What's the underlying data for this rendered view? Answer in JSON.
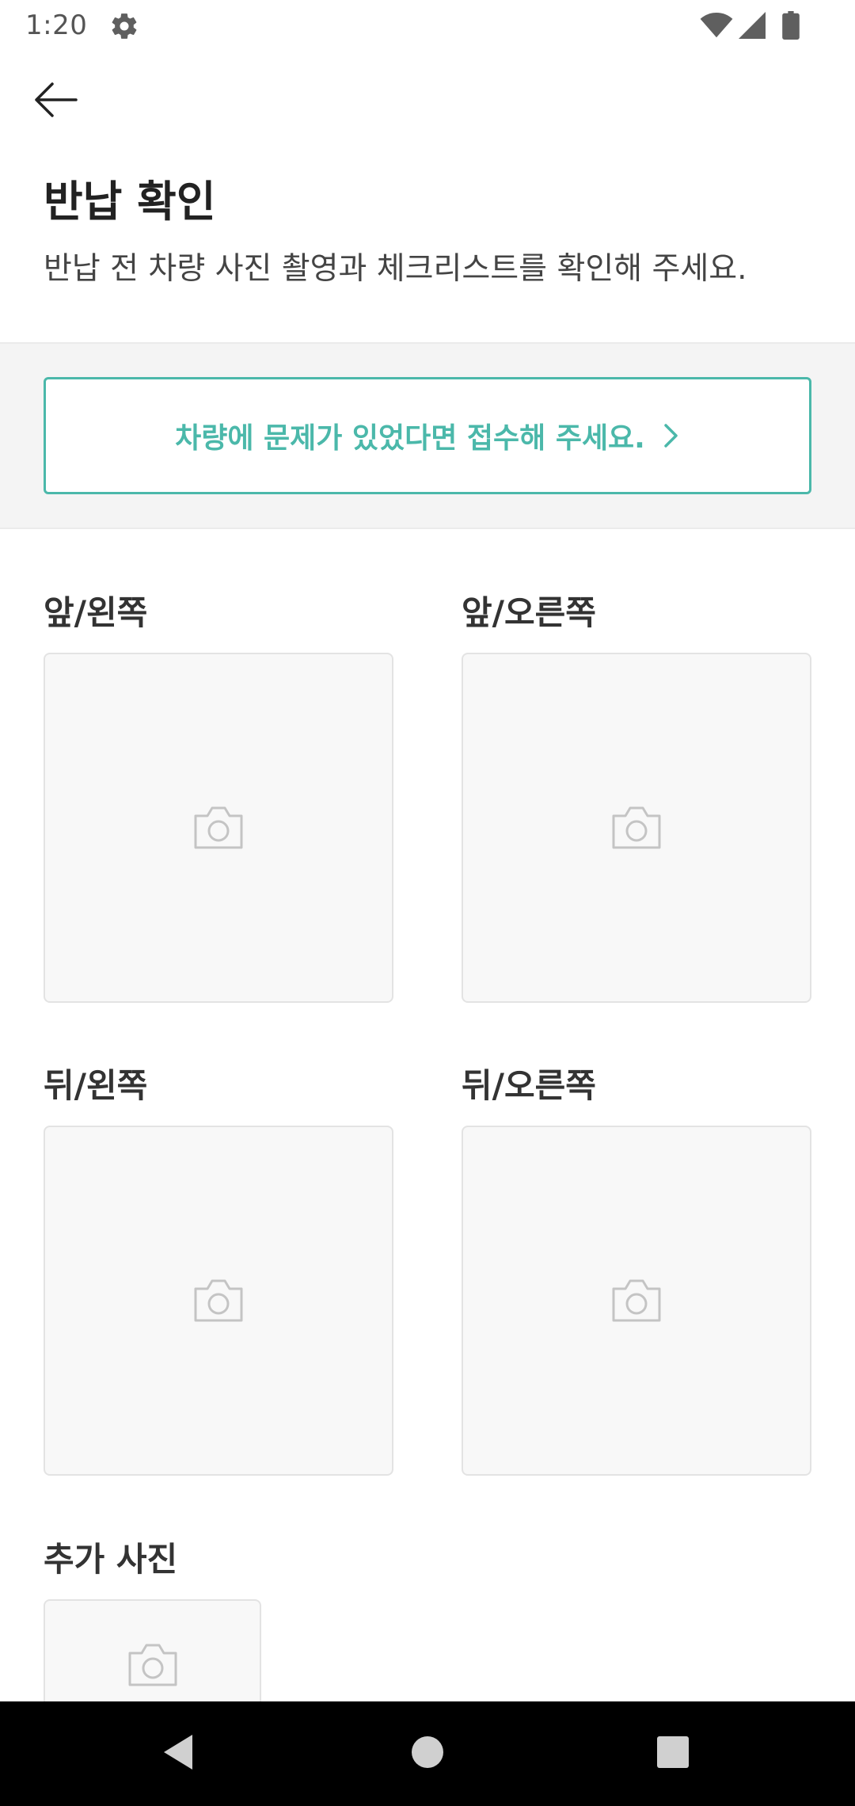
{
  "status_bar": {
    "time": "1:20",
    "icons": [
      "settings-gear-icon",
      "wifi-icon",
      "cellular-signal-icon",
      "battery-icon"
    ]
  },
  "header": {
    "back_icon": "arrow-left-icon",
    "title": "반납 확인",
    "subtitle": "반납 전 차량 사진 촬영과 체크리스트를 확인해 주세요."
  },
  "banner": {
    "label": "차량에 문제가 있었다면 접수해 주세요.",
    "chevron_icon": "chevron-right-icon",
    "accent_color": "#4bb8aa"
  },
  "photos": {
    "front_left": {
      "label": "앞/왼쪽",
      "icon": "camera-icon"
    },
    "front_right": {
      "label": "앞/오른쪽",
      "icon": "camera-icon"
    },
    "rear_left": {
      "label": "뒤/왼쪽",
      "icon": "camera-icon"
    },
    "rear_right": {
      "label": "뒤/오른쪽",
      "icon": "camera-icon"
    },
    "additional": {
      "label": "추가 사진",
      "icon": "camera-icon"
    }
  },
  "nav_bar": {
    "icons": [
      "nav-back-icon",
      "nav-home-icon",
      "nav-recents-icon"
    ]
  }
}
